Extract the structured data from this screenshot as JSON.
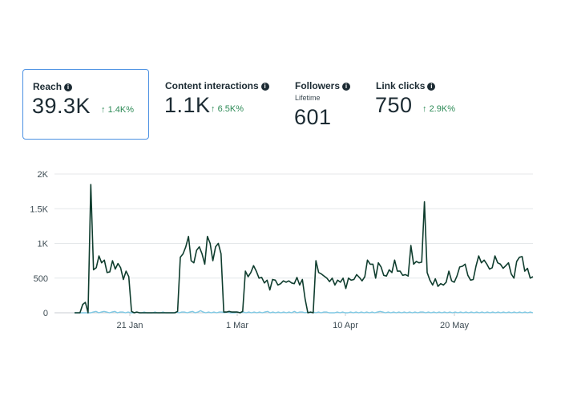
{
  "metrics": [
    {
      "title": "Reach",
      "value": "39.3K",
      "change": "1.4K%",
      "selected": true
    },
    {
      "title": "Content interactions",
      "value": "1.1K",
      "change": "6.5K%"
    },
    {
      "title": "Followers",
      "sublabel": "Lifetime",
      "value": "601"
    },
    {
      "title": "Link clicks",
      "value": "750",
      "change": "2.9K%"
    }
  ],
  "icons": {
    "info": "info-icon",
    "change": "arrow-up-icon"
  },
  "colors": {
    "current_series": "#0f3d2e",
    "previous_series": "#7ec8e3",
    "positive_change": "#2e8b57",
    "selected_border": "#4a90e2"
  },
  "chart_data": {
    "type": "line",
    "x_tick_labels": [
      "21 Jan",
      "1 Mar",
      "10 Apr",
      "20 May"
    ],
    "y_tick_labels": [
      "0",
      "500",
      "1K",
      "1.5K",
      "2K"
    ],
    "ylim": [
      0,
      2000
    ],
    "grid": true,
    "series": [
      {
        "values": [
          0,
          0,
          0,
          120,
          150,
          0,
          1850,
          620,
          650,
          820,
          720,
          760,
          580,
          590,
          750,
          630,
          710,
          650,
          480,
          600,
          520,
          20,
          0,
          10,
          0,
          0,
          0,
          0,
          0,
          0,
          0,
          0,
          0,
          0,
          0,
          0,
          0,
          0,
          20,
          800,
          850,
          950,
          1100,
          750,
          720,
          900,
          950,
          850,
          700,
          1100,
          1000,
          750,
          950,
          1000,
          850,
          10,
          10,
          20,
          10,
          10,
          10,
          0,
          20,
          600,
          520,
          580,
          680,
          600,
          500,
          510,
          430,
          470,
          330,
          480,
          470,
          400,
          420,
          460,
          440,
          460,
          430,
          420,
          510,
          400,
          480,
          200,
          0,
          10,
          0,
          750,
          580,
          560,
          530,
          500,
          450,
          500,
          400,
          470,
          440,
          500,
          350,
          500,
          470,
          480,
          550,
          510,
          460,
          520,
          760,
          700,
          700,
          500,
          720,
          660,
          540,
          530,
          620,
          580,
          760,
          600,
          600,
          540,
          550,
          530,
          970,
          700,
          740,
          720,
          730,
          1600,
          580,
          470,
          400,
          490,
          380,
          420,
          400,
          440,
          600,
          460,
          440,
          530,
          660,
          670,
          700,
          540,
          470,
          480,
          670,
          820,
          720,
          760,
          700,
          630,
          650,
          820,
          720,
          700,
          640,
          680,
          720,
          560,
          500,
          740,
          800,
          810,
          600,
          640,
          500,
          520
        ]
      },
      {
        "values": [
          0,
          0,
          0,
          0,
          0,
          0,
          0,
          10,
          20,
          0,
          10,
          20,
          10,
          0,
          10,
          20,
          0,
          10,
          10,
          0,
          10,
          0,
          0,
          10,
          0,
          0,
          10,
          0,
          0,
          0,
          10,
          0,
          0,
          10,
          0,
          0,
          0,
          0,
          10,
          0,
          10,
          10,
          0,
          10,
          20,
          0,
          10,
          30,
          10,
          0,
          10,
          0,
          10,
          0,
          10,
          10,
          0,
          10,
          0,
          0,
          0,
          10,
          0,
          10,
          0,
          10,
          0,
          10,
          0,
          10,
          0,
          10,
          20,
          0,
          10,
          0,
          10,
          0,
          10,
          0,
          10,
          0,
          20,
          0,
          10,
          10,
          0,
          10,
          0,
          10,
          0,
          10,
          0,
          10,
          10,
          0,
          0,
          0,
          10,
          0,
          10,
          0,
          0,
          10,
          0,
          10,
          0,
          10,
          0,
          10,
          0,
          10,
          0,
          10,
          20,
          10,
          0,
          10,
          0,
          10,
          0,
          10,
          0,
          10,
          0,
          10,
          0,
          10,
          0,
          10,
          10,
          0,
          10,
          0,
          10,
          0,
          10,
          0,
          10,
          0,
          10,
          0,
          10,
          0,
          10,
          0,
          10,
          0,
          10,
          0,
          10,
          0,
          10,
          0,
          10,
          0,
          10,
          0,
          10,
          0,
          10,
          0,
          10,
          0,
          10,
          0,
          10,
          0,
          10,
          0,
          10,
          0
        ]
      }
    ]
  }
}
